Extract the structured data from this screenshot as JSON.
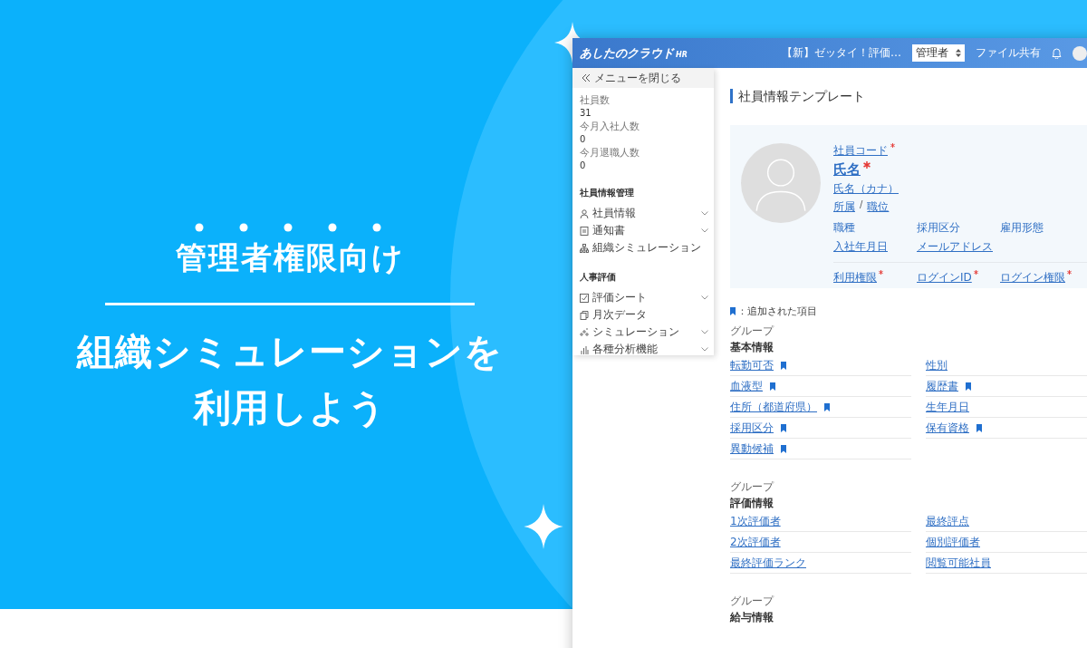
{
  "banner": {
    "heading": "管理者権限向け",
    "title_lines": [
      "組織シミュレーションを",
      "利用しよう"
    ]
  },
  "app": {
    "header": {
      "logo": "あしたのクラウド",
      "logo_suffix": "HR",
      "notice": "【新】ゼッタイ！評価…",
      "role_select": "管理者",
      "file_share": "ファイル共有"
    },
    "sidebar": {
      "close_menu": "メニューを閉じる",
      "stats": [
        {
          "label": "社員数",
          "value": "31"
        },
        {
          "label": "今月入社人数",
          "value": "0"
        },
        {
          "label": "今月退職人数",
          "value": "0"
        }
      ],
      "sections": [
        {
          "title": "社員情報管理",
          "items": [
            {
              "label": "社員情報",
              "kind": "person",
              "expandable": true
            },
            {
              "label": "通知書",
              "kind": "document",
              "expandable": true
            },
            {
              "label": "組織シミュレーション",
              "kind": "org",
              "expandable": false
            }
          ]
        },
        {
          "title": "人事評価",
          "items": [
            {
              "label": "評価シート",
              "kind": "check",
              "expandable": true
            },
            {
              "label": "月次データ",
              "kind": "copy",
              "expandable": false
            },
            {
              "label": "シミュレーション",
              "kind": "simulation",
              "expandable": true
            },
            {
              "label": "各種分析機能",
              "kind": "chart",
              "expandable": true
            }
          ]
        }
      ]
    },
    "page_title": "社員情報テンプレート",
    "profile": {
      "code_label": {
        "label": "社員コード",
        "required": true
      },
      "name_label": {
        "label": "氏名",
        "required": true
      },
      "kana_label": "氏名（カナ）",
      "department": "所属",
      "separator": "/",
      "position": "職位",
      "fields": [
        {
          "label": "職種",
          "required": false
        },
        {
          "label": "採用区分",
          "required": false
        },
        {
          "label": "雇用形態",
          "required": false
        },
        {
          "label": "入社年月日",
          "required": false
        },
        {
          "label": "メールアドレス",
          "required": false
        }
      ],
      "login_fields": [
        {
          "label": "利用権限",
          "required": true
        },
        {
          "label": "ログインID",
          "required": true
        },
        {
          "label": "ログイン権限",
          "required": true
        }
      ]
    },
    "legend": "：追加された項目",
    "groups": [
      {
        "caption": "グループ",
        "title": "基本情報",
        "fields": [
          {
            "label": "転勤可否",
            "added": true
          },
          {
            "label": "性別",
            "added": false
          },
          {
            "label": "血液型",
            "added": true
          },
          {
            "label": "履歴書",
            "added": true
          },
          {
            "label": "住所（都道府県）",
            "added": true
          },
          {
            "label": "生年月日",
            "added": false
          },
          {
            "label": "採用区分",
            "added": true
          },
          {
            "label": "保有資格",
            "added": true
          },
          {
            "label": "異動候補",
            "added": true
          }
        ]
      },
      {
        "caption": "グループ",
        "title": "評価情報",
        "fields": [
          {
            "label": "1次評価者",
            "added": false
          },
          {
            "label": "最終評点",
            "added": false
          },
          {
            "label": "2次評価者",
            "added": false
          },
          {
            "label": "個別評価者",
            "added": false
          },
          {
            "label": "最終評価ランク",
            "added": false
          },
          {
            "label": "閲覧可能社員",
            "added": false
          }
        ]
      },
      {
        "caption": "グループ",
        "title": "給与情報"
      }
    ]
  }
}
